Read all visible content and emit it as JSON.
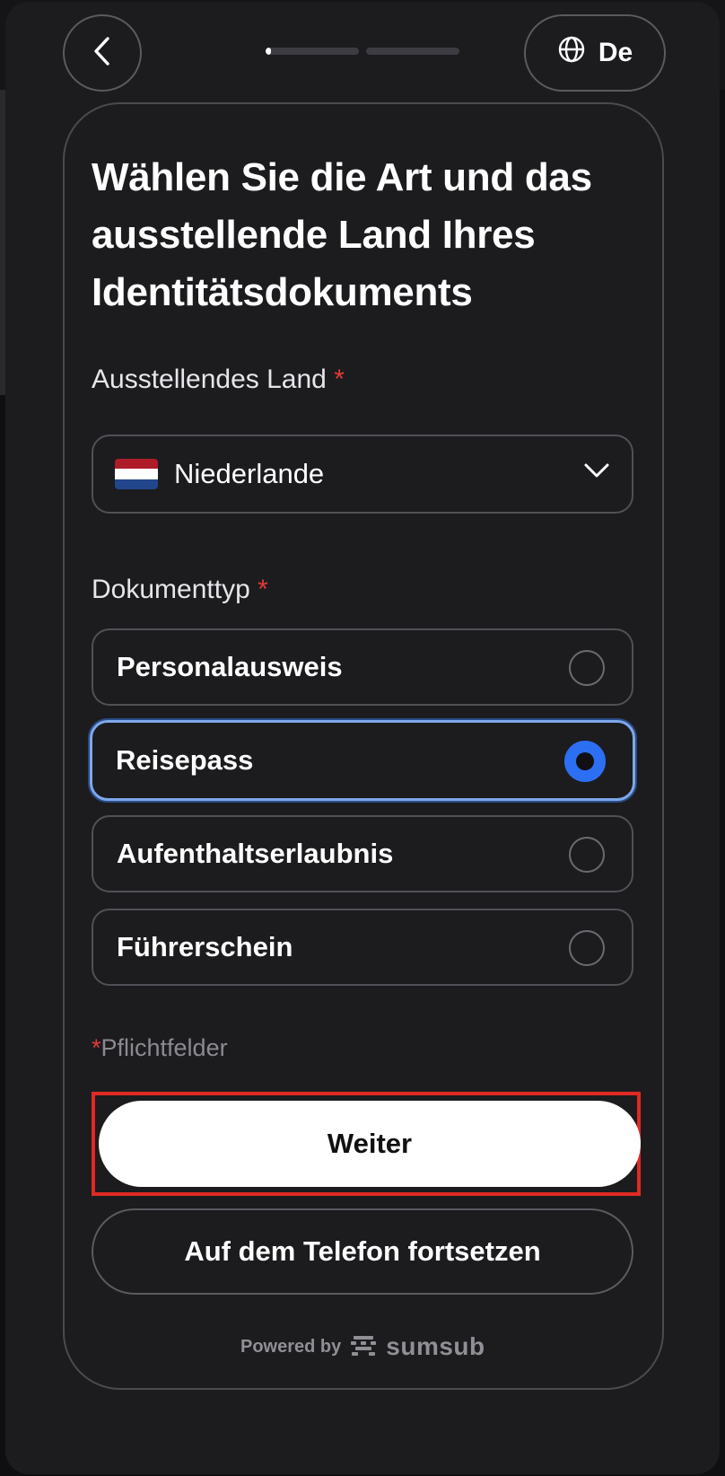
{
  "header": {
    "back_icon": "chevron-left-icon",
    "progress_fraction": [
      0.06,
      0
    ],
    "language_icon": "globe-icon",
    "language_label": "De"
  },
  "title": "Wählen Sie die Art und das ausstellende Land Ihres Identitätsdokuments",
  "country": {
    "label": "Ausstellendes Land",
    "required_mark": "*",
    "value": "Niederlande",
    "flag_colors": [
      "#AE1C28",
      "#FFFFFF",
      "#21468B"
    ],
    "dropdown_icon": "chevron-down-icon"
  },
  "doctype": {
    "label": "Dokumenttyp",
    "required_mark": "*",
    "options": [
      {
        "label": "Personalausweis",
        "selected": false
      },
      {
        "label": "Reisepass",
        "selected": true
      },
      {
        "label": "Aufenthaltserlaubnis",
        "selected": false
      },
      {
        "label": "Führerschein",
        "selected": false
      }
    ]
  },
  "required_note": {
    "mark": "*",
    "text": "Pflichtfelder"
  },
  "buttons": {
    "primary": "Weiter",
    "secondary": "Auf dem Telefon fortsetzen"
  },
  "footer": {
    "powered_by": "Powered by",
    "brand": "sumsub",
    "brand_icon": "sumsub-logo-icon"
  },
  "colors": {
    "accent": "#2D6FF2",
    "required": "#E53935",
    "highlight_box": "#E02A24"
  }
}
